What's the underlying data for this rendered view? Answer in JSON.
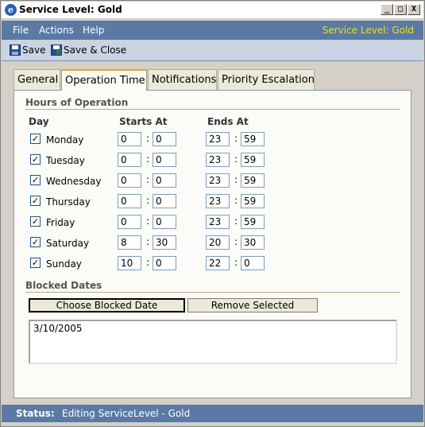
{
  "window": {
    "title": "Service Level: Gold",
    "controls": {
      "minimize": "_",
      "maximize": "□",
      "close": "X"
    }
  },
  "menu": {
    "items": [
      "File",
      "Actions",
      "Help"
    ],
    "service_level_label": "Service Level: Gold"
  },
  "toolbar": {
    "save_label": "Save",
    "save_close_label": "Save & Close"
  },
  "tabs": [
    {
      "label": "General",
      "active": false
    },
    {
      "label": "Operation Time",
      "active": true
    },
    {
      "label": "Notifications",
      "active": false
    },
    {
      "label": "Priority Escalation",
      "active": false
    }
  ],
  "hours": {
    "section_title": "Hours of Operation",
    "col_day": "Day",
    "col_starts": "Starts At",
    "col_ends": "Ends At",
    "rows": [
      {
        "day": "Monday",
        "checked": true,
        "start_h": "0",
        "start_m": "0",
        "end_h": "23",
        "end_m": "59"
      },
      {
        "day": "Tuesday",
        "checked": true,
        "start_h": "0",
        "start_m": "0",
        "end_h": "23",
        "end_m": "59"
      },
      {
        "day": "Wednesday",
        "checked": true,
        "start_h": "0",
        "start_m": "0",
        "end_h": "23",
        "end_m": "59"
      },
      {
        "day": "Thursday",
        "checked": true,
        "start_h": "0",
        "start_m": "0",
        "end_h": "23",
        "end_m": "59"
      },
      {
        "day": "Friday",
        "checked": true,
        "start_h": "0",
        "start_m": "0",
        "end_h": "23",
        "end_m": "59"
      },
      {
        "day": "Saturday",
        "checked": true,
        "start_h": "8",
        "start_m": "30",
        "end_h": "20",
        "end_m": "30"
      },
      {
        "day": "Sunday",
        "checked": true,
        "start_h": "10",
        "start_m": "0",
        "end_h": "22",
        "end_m": "0"
      }
    ]
  },
  "blocked": {
    "section_title": "Blocked Dates",
    "choose_label": "Choose Blocked Date",
    "remove_label": "Remove Selected",
    "dates": [
      "3/10/2005"
    ]
  },
  "status": {
    "label": "Status:",
    "text": "Editing ServiceLevel - Gold"
  },
  "colors": {
    "menubar": "#5a7aa5",
    "accent_yellow": "#e8e020",
    "tab_active_top": "#e8a030"
  }
}
